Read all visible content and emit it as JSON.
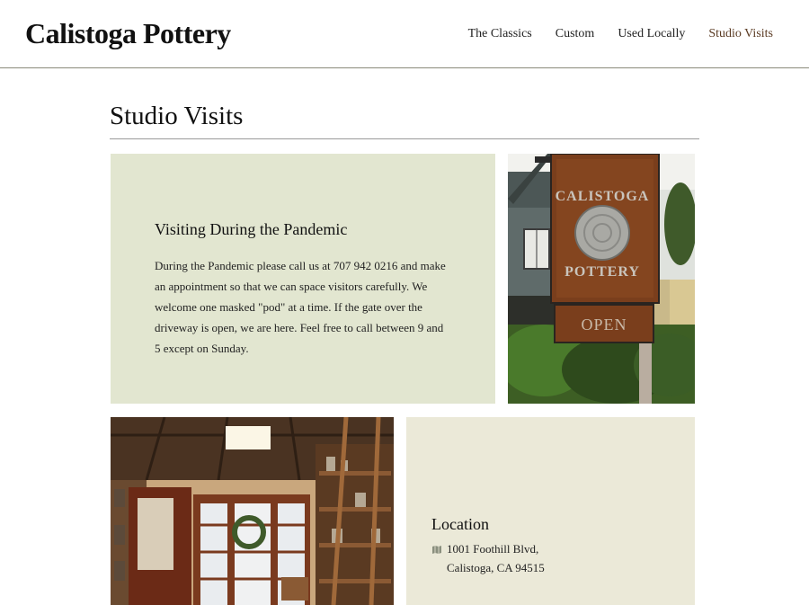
{
  "header": {
    "logo": "Calistoga Pottery",
    "nav": [
      {
        "label": "The Classics"
      },
      {
        "label": "Custom"
      },
      {
        "label": "Used Locally"
      },
      {
        "label": "Studio Visits"
      }
    ],
    "active_nav": "Studio Visits"
  },
  "main": {
    "title": "Studio Visits",
    "pandemic": {
      "heading": "Visiting During the Pandemic",
      "body": "During the Pandemic please call us at 707 942 0216 and make an appointment so that we can space visitors carefully. We welcome one masked \"pod\" at a time. If the gate over the driveway is open, we are here. Feel free to call between 9 and 5 except on Sunday."
    },
    "sign_photo": {
      "sign_line1": "CALISTOGA",
      "sign_line2": "POTTERY",
      "sign_open": "OPEN"
    },
    "location": {
      "heading": "Location",
      "icon": "map-icon",
      "address_line1": "1001 Foothill Blvd,",
      "address_line2": "Calistoga, CA 94515"
    }
  },
  "colors": {
    "panel_green": "#e2e6d0",
    "panel_location": "#ebe9d8",
    "active_nav": "#5a3a22",
    "rust": "#7a3e1c"
  }
}
